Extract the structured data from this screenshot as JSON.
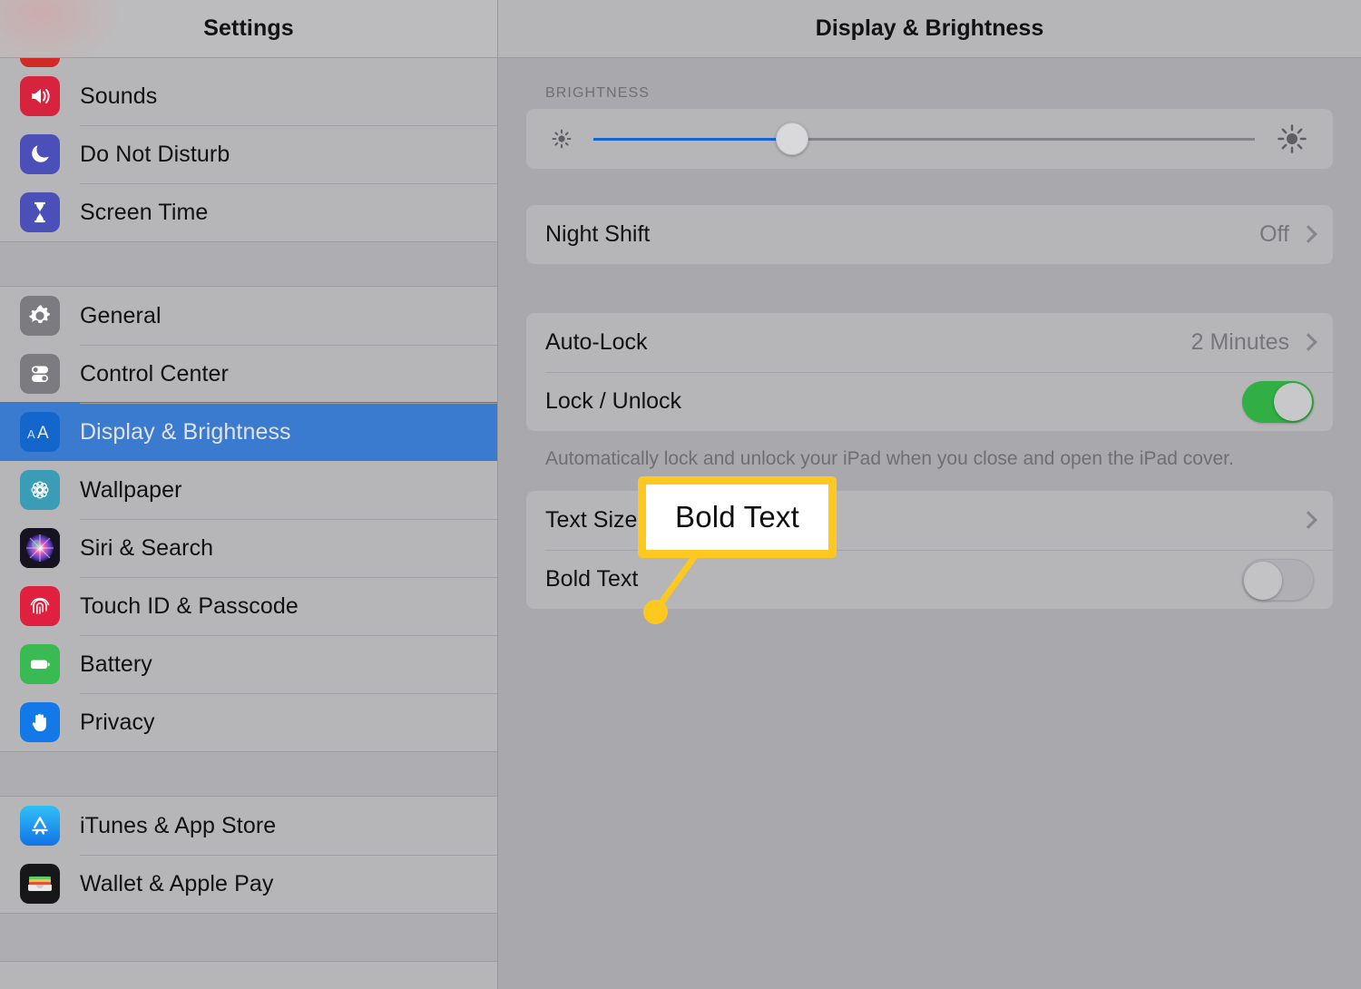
{
  "sidebar": {
    "title": "Settings",
    "clipped_top_item": {
      "label": "",
      "icon": "notifications-icon",
      "color": "#d12a26"
    },
    "groups": [
      {
        "items": [
          {
            "label": "Sounds",
            "icon": "sounds-icon",
            "color": "#d8233f"
          },
          {
            "label": "Do Not Disturb",
            "icon": "moon-icon",
            "color": "#4b4fb8"
          },
          {
            "label": "Screen Time",
            "icon": "hourglass-icon",
            "color": "#4b4fb8"
          }
        ]
      },
      {
        "items": [
          {
            "label": "General",
            "icon": "gear-icon",
            "color": "#7c7c80",
            "selected": false
          },
          {
            "label": "Control Center",
            "icon": "sliders-icon",
            "color": "#7c7c80",
            "selected": false
          },
          {
            "label": "Display & Brightness",
            "icon": "text-size-aa-icon",
            "color": "#1266cc",
            "selected": true
          },
          {
            "label": "Wallpaper",
            "icon": "flower-icon",
            "color": "#3a9cb5",
            "selected": false
          },
          {
            "label": "Siri & Search",
            "icon": "siri-icon",
            "color": "#16121f",
            "selected": false
          },
          {
            "label": "Touch ID & Passcode",
            "icon": "fingerprint-icon",
            "color": "#e0203f",
            "selected": false
          },
          {
            "label": "Battery",
            "icon": "battery-icon",
            "color": "#3aba52",
            "selected": false
          },
          {
            "label": "Privacy",
            "icon": "hand-icon",
            "color": "#1479e8",
            "selected": false
          }
        ]
      },
      {
        "items": [
          {
            "label": "iTunes & App Store",
            "icon": "app-store-icon",
            "color": "#1d9bf0"
          },
          {
            "label": "Wallet & Apple Pay",
            "icon": "wallet-icon",
            "color": "#17171a"
          }
        ]
      }
    ]
  },
  "detail": {
    "title": "Display & Brightness",
    "brightness": {
      "section_label": "BRIGHTNESS",
      "value_percent": 30,
      "low_icon": "sun-small-icon",
      "high_icon": "sun-large-icon"
    },
    "night_shift": {
      "label": "Night Shift",
      "value": "Off",
      "chevron": "chevron-right-icon"
    },
    "auto_lock": {
      "label": "Auto-Lock",
      "value": "2 Minutes",
      "chevron": "chevron-right-icon"
    },
    "lock_unlock": {
      "label": "Lock / Unlock",
      "toggle_state": "on"
    },
    "lock_footnote": "Automatically lock and unlock your iPad when you close and open the iPad cover.",
    "text_size": {
      "label": "Text Size",
      "chevron": "chevron-right-icon"
    },
    "bold_text": {
      "label": "Bold Text",
      "toggle_state": "off"
    }
  },
  "callout": {
    "text": "Bold Text",
    "border_color": "#fdc81f",
    "background_color": "#ffffff",
    "pointer_color": "#fdc81f"
  },
  "colors": {
    "selection_blue": "#3a7bd0",
    "slider_fill": "#1863d6",
    "toggle_on_green": "#31ae44",
    "sidebar_bg": "#b6b6b8",
    "detail_bg": "#a8a8ad"
  }
}
